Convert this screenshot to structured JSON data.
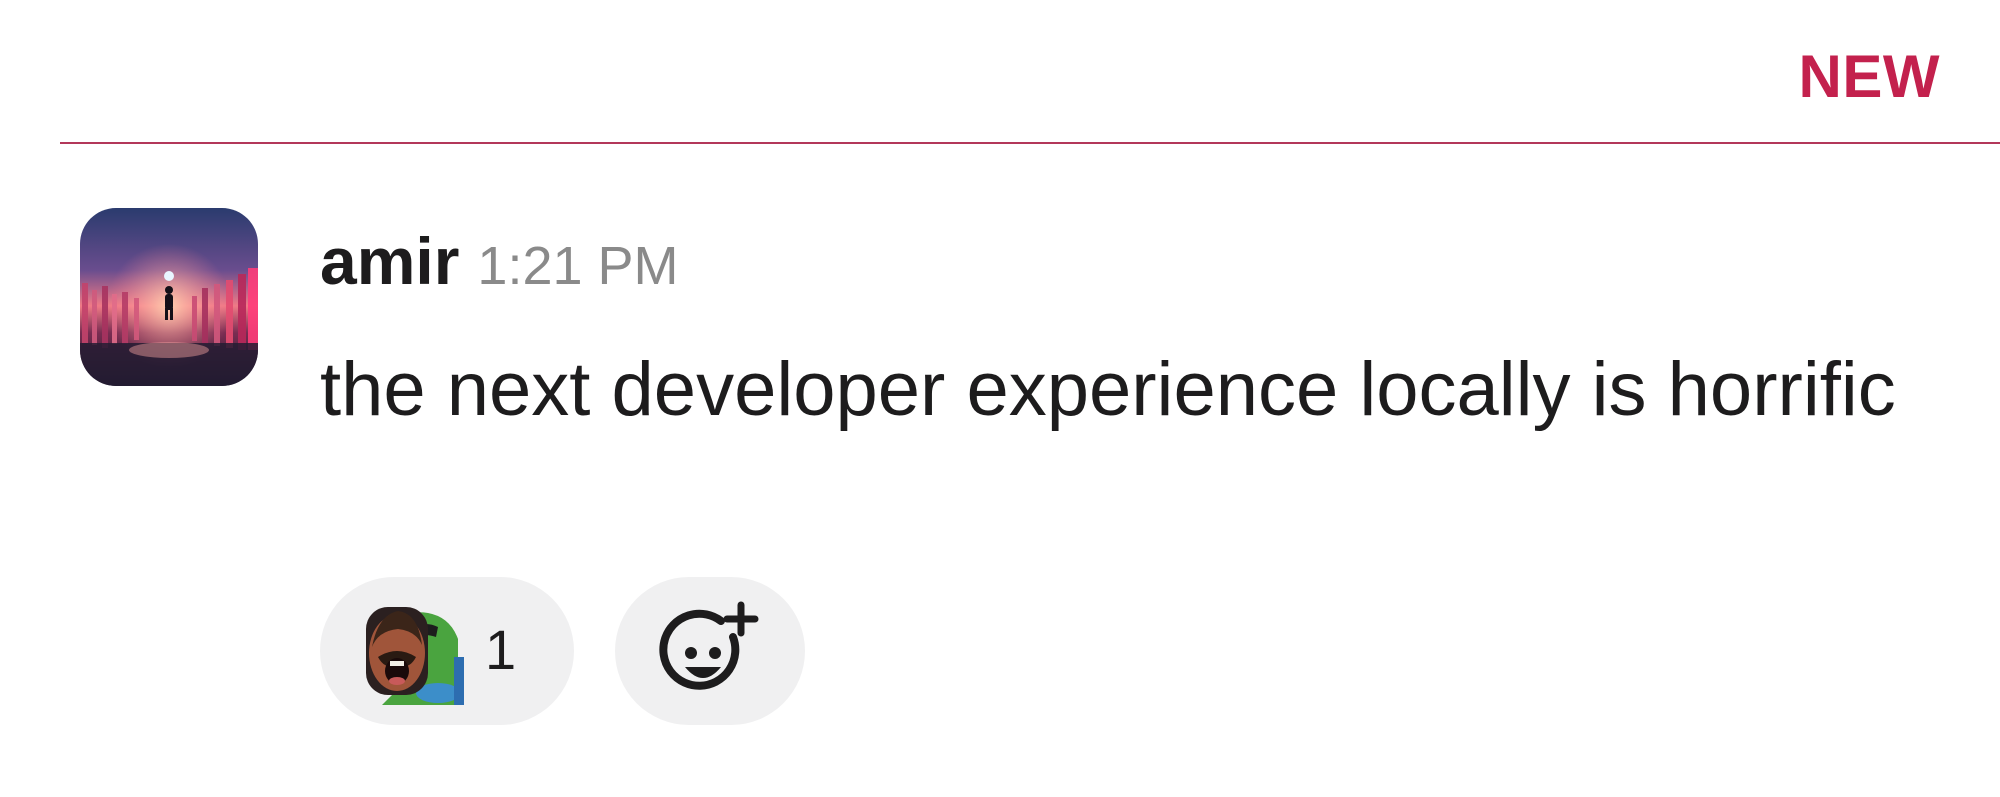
{
  "divider": {
    "label": "NEW",
    "color": "#c3214d"
  },
  "message": {
    "avatar_icon": "user-avatar-image",
    "username": "amir",
    "timestamp": "1:21 PM",
    "text": "the next developer experience locally is horrific",
    "reactions": [
      {
        "emoji_icon": "custom-emoji-icon",
        "count": "1"
      }
    ],
    "add_reaction_icon": "add-emoji-icon"
  }
}
